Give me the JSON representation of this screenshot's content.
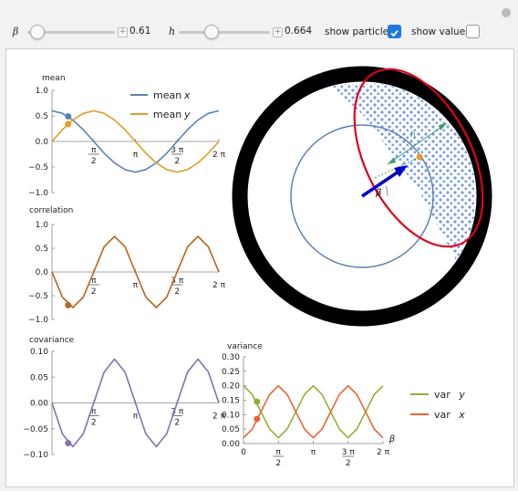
{
  "controls": {
    "beta": {
      "label": "β",
      "value_text": "0.61",
      "value": 0.61,
      "range": [
        0,
        6.283
      ]
    },
    "h": {
      "label": "h",
      "value_text": "0.664",
      "value": 0.664,
      "range": [
        0,
        1
      ]
    },
    "show_particles": {
      "label": "show particles",
      "checked": true
    },
    "show_values": {
      "label": "show values",
      "checked": false
    }
  },
  "icons": {
    "settings": "gear-icon",
    "increment": "plus-icon"
  },
  "colors": {
    "mean_x": "#5e81b5",
    "mean_y": "#e19c24",
    "correlation": "#b5651d",
    "covariance": "#8172b3",
    "var_y": "#8fb032",
    "var_x": "#eb6235",
    "ellipse": "#e0001b",
    "particles": "#7799ee",
    "arrow": "#0000cc",
    "circle": "#5e81b5",
    "hline": "#3a9c6a"
  },
  "chart_data": [
    {
      "type": "line",
      "title": "mean",
      "x": [
        0,
        0.393,
        0.785,
        1.178,
        1.571,
        1.963,
        2.356,
        2.749,
        3.142,
        3.534,
        3.927,
        4.32,
        4.712,
        5.105,
        5.498,
        5.89,
        6.283
      ],
      "series": [
        {
          "name": "mean x",
          "values": [
            0.6,
            0.55,
            0.42,
            0.23,
            0.0,
            -0.23,
            -0.42,
            -0.55,
            -0.6,
            -0.55,
            -0.42,
            -0.23,
            0.0,
            0.23,
            0.42,
            0.55,
            0.6
          ]
        },
        {
          "name": "mean y",
          "values": [
            0.0,
            0.23,
            0.42,
            0.55,
            0.6,
            0.55,
            0.42,
            0.23,
            0.0,
            -0.23,
            -0.42,
            -0.55,
            -0.6,
            -0.55,
            -0.42,
            -0.23,
            0.0
          ]
        }
      ],
      "marker": {
        "x": 0.61,
        "values": [
          0.49,
          0.34
        ]
      },
      "ylim": [
        -1.0,
        1.0
      ],
      "yticks": [
        "1.0",
        "0.5",
        "0.0",
        "−0.5",
        "−1.0"
      ],
      "xticks": [
        {
          "num": "π",
          "den": "2"
        },
        {
          "num": "π",
          "den": ""
        },
        {
          "num": "3 π",
          "den": "2"
        },
        {
          "num": "2 π",
          "den": ""
        }
      ],
      "legend": "top-right"
    },
    {
      "type": "line",
      "title": "correlation",
      "x": [
        0,
        0.393,
        0.785,
        1.178,
        1.571,
        1.963,
        2.356,
        2.749,
        3.142,
        3.534,
        3.927,
        4.32,
        4.712,
        5.105,
        5.498,
        5.89,
        6.283
      ],
      "series": [
        {
          "name": "",
          "values": [
            0.0,
            -0.53,
            -0.75,
            -0.53,
            0.0,
            0.53,
            0.75,
            0.53,
            0.0,
            -0.53,
            -0.75,
            -0.53,
            0.0,
            0.53,
            0.75,
            0.53,
            0.0
          ]
        }
      ],
      "marker": {
        "x": 0.61,
        "values": [
          -0.7
        ]
      },
      "ylim": [
        -1.0,
        1.0
      ],
      "yticks": [
        "1.0",
        "0.5",
        "0.0",
        "−0.5",
        "−1.0"
      ],
      "xticks": [
        {
          "num": "π",
          "den": "2"
        },
        {
          "num": "π",
          "den": ""
        },
        {
          "num": "3 π",
          "den": "2"
        },
        {
          "num": "2 π",
          "den": ""
        }
      ]
    },
    {
      "type": "line",
      "title": "covariance",
      "x": [
        0,
        0.393,
        0.785,
        1.178,
        1.571,
        1.963,
        2.356,
        2.749,
        3.142,
        3.534,
        3.927,
        4.32,
        4.712,
        5.105,
        5.498,
        5.89,
        6.283
      ],
      "series": [
        {
          "name": "",
          "values": [
            0.0,
            -0.06,
            -0.085,
            -0.06,
            0.0,
            0.06,
            0.085,
            0.06,
            0.0,
            -0.06,
            -0.085,
            -0.06,
            0.0,
            0.06,
            0.085,
            0.06,
            0.0
          ]
        }
      ],
      "marker": {
        "x": 0.61,
        "values": [
          -0.078
        ]
      },
      "ylim": [
        -0.1,
        0.1
      ],
      "yticks": [
        "0.10",
        "0.05",
        "0.00",
        "−0.05",
        "−0.10"
      ],
      "xticks": [
        {
          "num": "π",
          "den": "2"
        },
        {
          "num": "π",
          "den": ""
        },
        {
          "num": "3 π",
          "den": "2"
        },
        {
          "num": "2 π",
          "den": ""
        }
      ]
    },
    {
      "type": "line",
      "title": "variance",
      "xlabel": "β",
      "x": [
        0,
        0.393,
        0.785,
        1.178,
        1.571,
        1.963,
        2.356,
        2.749,
        3.142,
        3.534,
        3.927,
        4.32,
        4.712,
        5.105,
        5.498,
        5.89,
        6.283
      ],
      "series": [
        {
          "name": "var y",
          "values": [
            0.2,
            0.17,
            0.11,
            0.05,
            0.02,
            0.05,
            0.11,
            0.17,
            0.2,
            0.17,
            0.11,
            0.05,
            0.02,
            0.05,
            0.11,
            0.17,
            0.2
          ]
        },
        {
          "name": "var x",
          "values": [
            0.02,
            0.05,
            0.11,
            0.17,
            0.2,
            0.17,
            0.11,
            0.05,
            0.02,
            0.05,
            0.11,
            0.17,
            0.2,
            0.17,
            0.11,
            0.05,
            0.02
          ]
        }
      ],
      "marker": {
        "x": 0.61,
        "values": [
          0.145,
          0.085
        ]
      },
      "ylim": [
        0.0,
        0.3
      ],
      "yticks": [
        "0.30",
        "0.25",
        "0.20",
        "0.15",
        "0.10",
        "0.05",
        "0.00"
      ],
      "xticks": [
        {
          "num": "0",
          "den": ""
        },
        {
          "num": "π",
          "den": "2"
        },
        {
          "num": "π",
          "den": ""
        },
        {
          "num": "3 π",
          "den": "2"
        },
        {
          "num": "2 π",
          "den": ""
        }
      ],
      "legend": "right"
    }
  ],
  "diagram": {
    "arrow_label": "β",
    "segment_label": "h"
  }
}
